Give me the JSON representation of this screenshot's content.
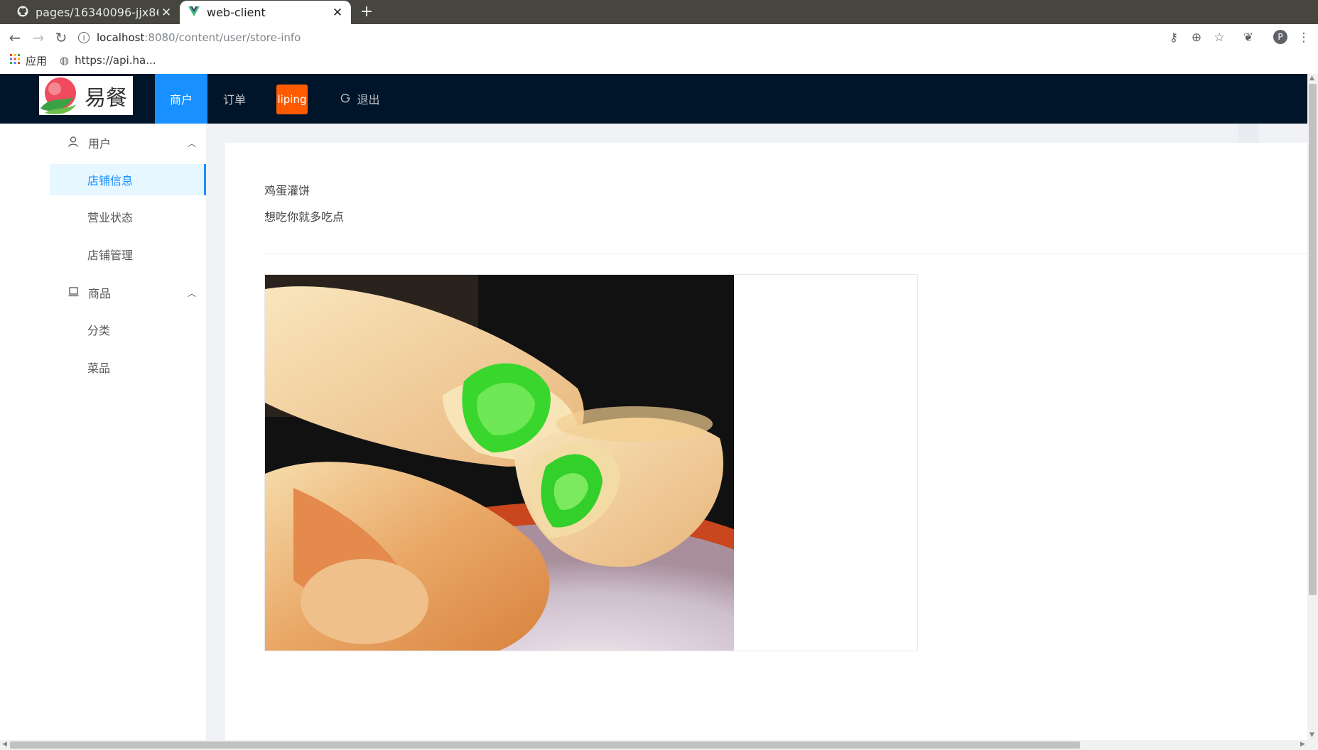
{
  "browser": {
    "tabs": [
      {
        "title": "pages/16340096-jjx8622jjx",
        "active": false
      },
      {
        "title": "web-client",
        "active": true
      }
    ],
    "url_host": "localhost",
    "url_path": ":8080/content/user/store-info",
    "bookmarks": [
      {
        "label": "应用",
        "icon": "apps-grid-icon"
      },
      {
        "label": "https://api.ha...",
        "icon": "globe-icon"
      }
    ],
    "profile_initial": "P"
  },
  "app": {
    "logo_text": "易餐",
    "nav": {
      "merchant": "商户",
      "orders": "订单",
      "user": "liping",
      "logout": "退出"
    },
    "accent_color": "#1890ff",
    "header_color": "#001529",
    "user_badge_color": "#ff5a00"
  },
  "sidebar": {
    "groups": [
      {
        "title": "用户",
        "icon": "user-icon",
        "items": [
          {
            "label": "店铺信息",
            "selected": true
          },
          {
            "label": "营业状态",
            "selected": false
          },
          {
            "label": "店铺管理",
            "selected": false
          }
        ]
      },
      {
        "title": "商品",
        "icon": "laptop-icon",
        "items": [
          {
            "label": "分类",
            "selected": false
          },
          {
            "label": "菜品",
            "selected": false
          }
        ]
      }
    ]
  },
  "store": {
    "name": "鸡蛋灌饼",
    "slogan": "想吃你就多吃点",
    "image_alt": "egg pancake roll photo"
  }
}
